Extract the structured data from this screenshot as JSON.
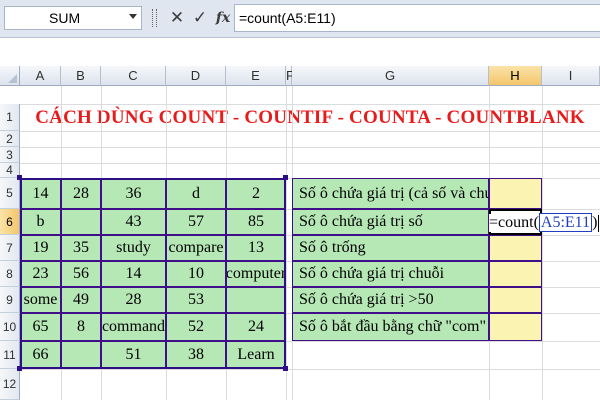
{
  "formula_bar": {
    "name_box": "SUM",
    "cancel_icon": "✕",
    "enter_icon": "✓",
    "fx_label": "fx",
    "formula": "=count(A5:E11)"
  },
  "columns": [
    "A",
    "B",
    "C",
    "D",
    "E",
    "F",
    "G",
    "H",
    "I"
  ],
  "active_column": "H",
  "rows": [
    "1",
    "2",
    "3",
    "4",
    "5",
    "6",
    "7",
    "8",
    "9",
    "10",
    "11",
    "12"
  ],
  "active_row": "6",
  "title": "CÁCH DÙNG COUNT - COUNTIF - COUNTA - COUNTBLANK",
  "table": [
    [
      "14",
      "28",
      "36",
      "d",
      "2"
    ],
    [
      "b",
      "",
      "43",
      "57",
      "85"
    ],
    [
      "19",
      "35",
      "study",
      "compare",
      "13"
    ],
    [
      "23",
      "56",
      "14",
      "10",
      "computer"
    ],
    [
      "some",
      "49",
      "28",
      "53",
      ""
    ],
    [
      "65",
      "8",
      "command",
      "52",
      "24"
    ],
    [
      "66",
      "",
      "51",
      "38",
      "Learn"
    ]
  ],
  "criteria": [
    "Số ô chứa giá trị (cả số và chuỗi)",
    "Số ô chứa giá trị số",
    "Số ô trống",
    "Số ô chứa giá trị chuỗi",
    "Số ô chứa giá trị >50",
    "Số ô bắt đầu bằng chữ \"com\""
  ],
  "editing_cell": {
    "prefix": "=count(",
    "reference": "A5:E11",
    "suffix": ")"
  },
  "colors": {
    "title": "#e81b1b",
    "cell_fill": "#b6e8b6",
    "result_fill": "#fbf3b2",
    "border": "#3f0f8a",
    "reference": "#1f3fbf"
  }
}
